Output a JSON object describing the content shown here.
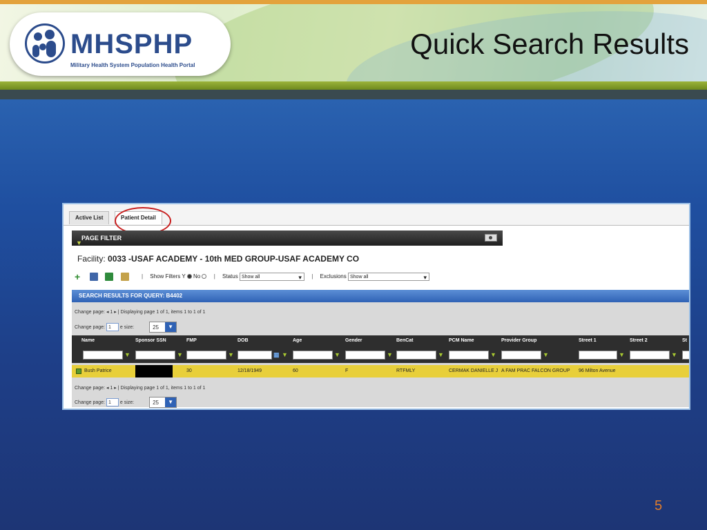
{
  "slide": {
    "title": "Quick Search Results",
    "page_number": "5",
    "logo_text": "MHSPHP",
    "logo_subtitle": "Military Health System Population Health Portal"
  },
  "app": {
    "tabs": [
      {
        "label": "Active List",
        "active": true
      },
      {
        "label": "Patient Detail",
        "active": false
      }
    ],
    "page_filter_label": "PAGE FILTER",
    "facility_label": "Facility:",
    "facility_value": "0033 -USAF ACADEMY - 10th MED GROUP-USAF ACADEMY CO",
    "toolbar": {
      "show_filters_label": "Show Filters",
      "show_filters_yes": "Y",
      "show_filters_no": "No",
      "status_label": "Status",
      "status_value": "Show all",
      "exclusions_label": "Exclusions",
      "exclusions_value": "Show all"
    },
    "search_results_label": "SEARCH RESULTS FOR QUERY: B4402",
    "pager_top": {
      "change_page": "Change page:",
      "page_nav": "◂ 1 ▸ | Displaying page 1 of 1, items 1 to 1 of 1",
      "page_input": "1",
      "page_size_label": "e size:",
      "page_size_value": "25"
    },
    "pager_bottom": {
      "change_page": "Change page:",
      "page_nav": "◂ 1 ▸ | Displaying page 1 of 1, items 1 to 1 of 1",
      "page_input": "1",
      "page_size_label": "e size:",
      "page_size_value": "25"
    },
    "columns": [
      "Name",
      "Sponsor SSN",
      "FMP",
      "DOB",
      "Age",
      "Gender",
      "BenCat",
      "PCM Name",
      "Provider Group",
      "Street 1",
      "Street 2",
      "St"
    ],
    "row": {
      "name": "Bush Patrice",
      "sponsor_ssn": "",
      "fmp": "30",
      "dob": "12/18/1949",
      "age": "60",
      "gender": "F",
      "bencat": "RTFMLY",
      "pcm_name": "CERMAK DANIELLE J",
      "provider_group": "A FAM PRAC FALCON GROUP",
      "street1": "96 Milton Avenue"
    }
  },
  "colors": {
    "accent_page_number": "#e07b2a",
    "highlight_row": "#e8cf3a",
    "annotation_circle": "#c81e1e"
  }
}
